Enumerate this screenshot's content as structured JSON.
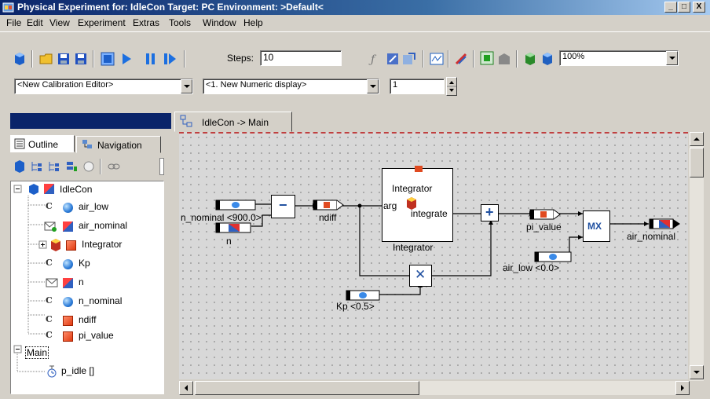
{
  "window": {
    "title": "Physical Experiment for: IdleCon  Target: PC  Environment: >Default<",
    "controls": [
      "_",
      "□",
      "X"
    ]
  },
  "menu": [
    "File",
    "Edit",
    "View",
    "Experiment",
    "Extras",
    "Tools",
    "Window",
    "Help"
  ],
  "toolbar": {
    "steps_label": "Steps:",
    "steps_value": "10",
    "zoom_value": "100%"
  },
  "calib_bar": {
    "editor_select": "<New Calibration Editor>",
    "display_select": "<1. New Numeric display>",
    "count_value": "1"
  },
  "left_panel": {
    "tabs": [
      "Outline",
      "Navigation"
    ],
    "tree": [
      {
        "label": "IdleCon",
        "icon": "model-icon"
      },
      {
        "label": "air_low",
        "icon": "calibration-variable-icon"
      },
      {
        "label": "air_nominal",
        "icon": "send-message-icon"
      },
      {
        "label": "Integrator",
        "icon": "class-instance-icon"
      },
      {
        "label": "Kp",
        "icon": "calibration-variable-icon"
      },
      {
        "label": "n",
        "icon": "receive-message-icon"
      },
      {
        "label": "n_nominal",
        "icon": "calibration-variable-icon"
      },
      {
        "label": "ndiff",
        "icon": "variable-icon"
      },
      {
        "label": "pi_value",
        "icon": "variable-icon"
      },
      {
        "label": "Main",
        "icon": "folder-icon"
      },
      {
        "label": "p_idle []",
        "icon": "process-icon"
      }
    ]
  },
  "editor": {
    "tab_label": "IdleCon -> Main",
    "blocks": {
      "n_nominal": "n_nominal <900.0>",
      "n": "n",
      "ndiff": "ndiff",
      "integrator_title": "Integrator",
      "integrator_arg": "arg",
      "integrator_method": "integrate",
      "integrator_name": "Integrator",
      "pi_value": "pi_value",
      "mx": "MX",
      "air_nominal": "air_nominal",
      "air_low": "air_low <0.0>",
      "kp": "Kp <0.5>",
      "minus": "−",
      "plus": "+",
      "times": "✕"
    }
  }
}
